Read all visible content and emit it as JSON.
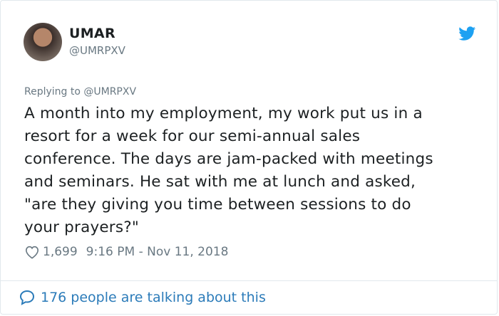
{
  "author": {
    "display_name": "UMAR",
    "handle": "@UMRPXV"
  },
  "tweet": {
    "replying_to": "Replying to @UMRPXV",
    "text": "A month into my employment, my work put us in a\nresort for a week for our semi-annual sales\nconference. The days are jam-packed with meetings\nand seminars. He sat with me at lunch and asked,\n\"are they giving you time between sessions to do\nyour prayers?\"",
    "likes": "1,699",
    "timestamp": "9:16 PM - Nov 11, 2018"
  },
  "footer": {
    "talking_text": "176 people are talking about this"
  },
  "icons": {
    "bird": "twitter-bird-icon",
    "heart": "heart-icon",
    "bubble": "speech-bubble-icon"
  },
  "colors": {
    "twitter_blue": "#1da1f2",
    "link_blue": "#2b7bb9",
    "meta_gray": "#697882",
    "text_dark": "#1c2022"
  }
}
